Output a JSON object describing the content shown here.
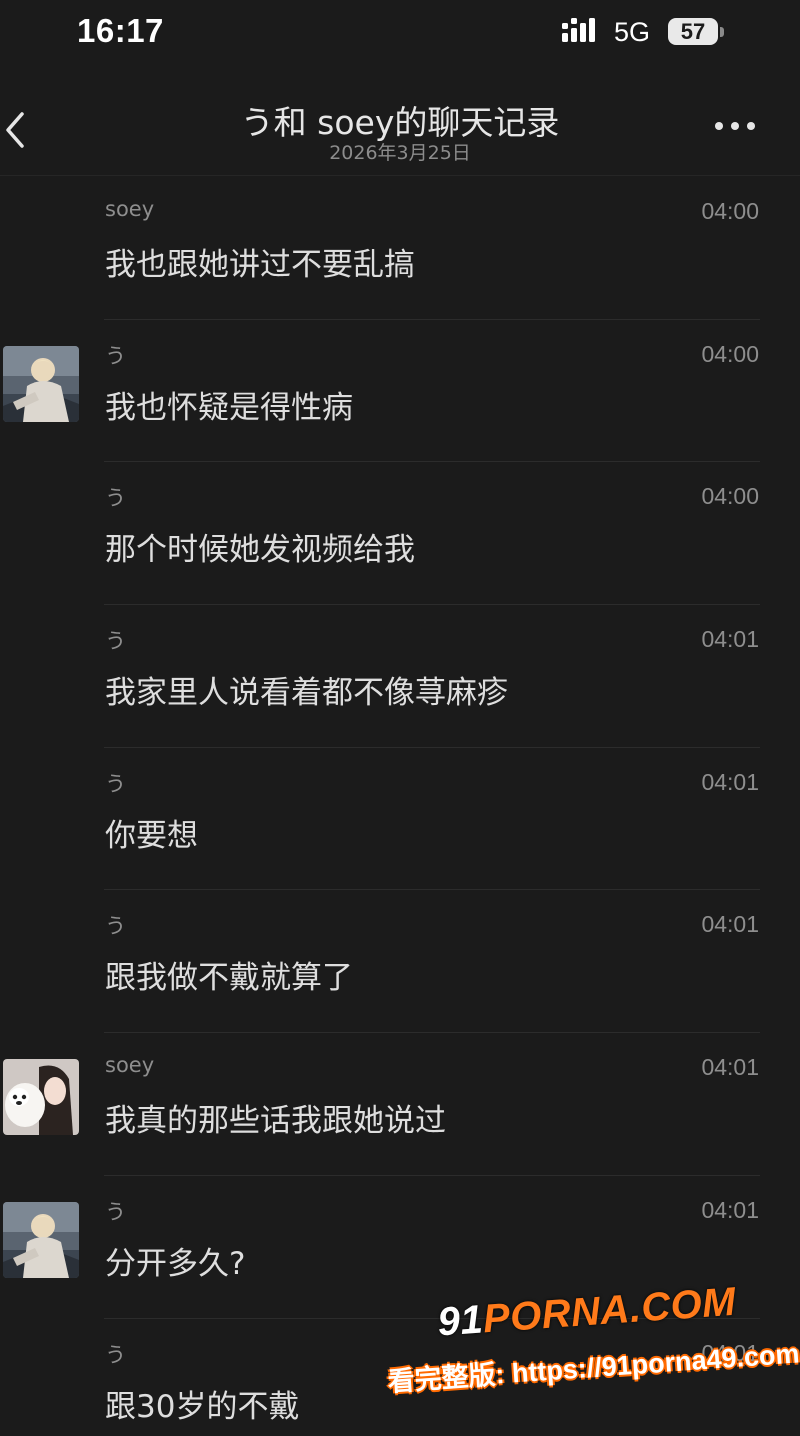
{
  "status_bar": {
    "time": "16:17",
    "network": "5G",
    "battery": "57"
  },
  "nav": {
    "title": "う和 soey的聊天记录",
    "subtitle": "2026年3月25日",
    "back_icon": "chevron-left-icon",
    "more_icon": "more-dots-icon"
  },
  "messages": [
    {
      "sender": "soey",
      "time": "04:00",
      "text": "我也跟她讲过不要乱搞",
      "avatar": "none"
    },
    {
      "sender": "う",
      "time": "04:00",
      "text": "我也怀疑是得性病",
      "avatar": "man-photo"
    },
    {
      "sender": "う",
      "time": "04:00",
      "text": "那个时候她发视频给我",
      "avatar": "none"
    },
    {
      "sender": "う",
      "time": "04:01",
      "text": "我家里人说看着都不像荨麻疹",
      "avatar": "none"
    },
    {
      "sender": "う",
      "time": "04:01",
      "text": "你要想",
      "avatar": "none"
    },
    {
      "sender": "う",
      "time": "04:01",
      "text": "跟我做不戴就算了",
      "avatar": "none"
    },
    {
      "sender": "soey",
      "time": "04:01",
      "text": "我真的那些话我跟她说过",
      "avatar": "woman-dog-photo"
    },
    {
      "sender": "う",
      "time": "04:01",
      "text": "分开多久?",
      "avatar": "man-photo"
    },
    {
      "sender": "う",
      "time": "04:01",
      "text": "跟30岁的不戴",
      "avatar": "none"
    }
  ],
  "watermark": {
    "logo_prefix": "91",
    "logo_main": "PORNA.COM",
    "url": "看完整版: https://91porna49.com"
  },
  "colors": {
    "background": "#1b1b1b",
    "primary_text": "#dedede",
    "secondary_text": "#8e8e8e",
    "watermark_accent": "#ff7a1a"
  }
}
